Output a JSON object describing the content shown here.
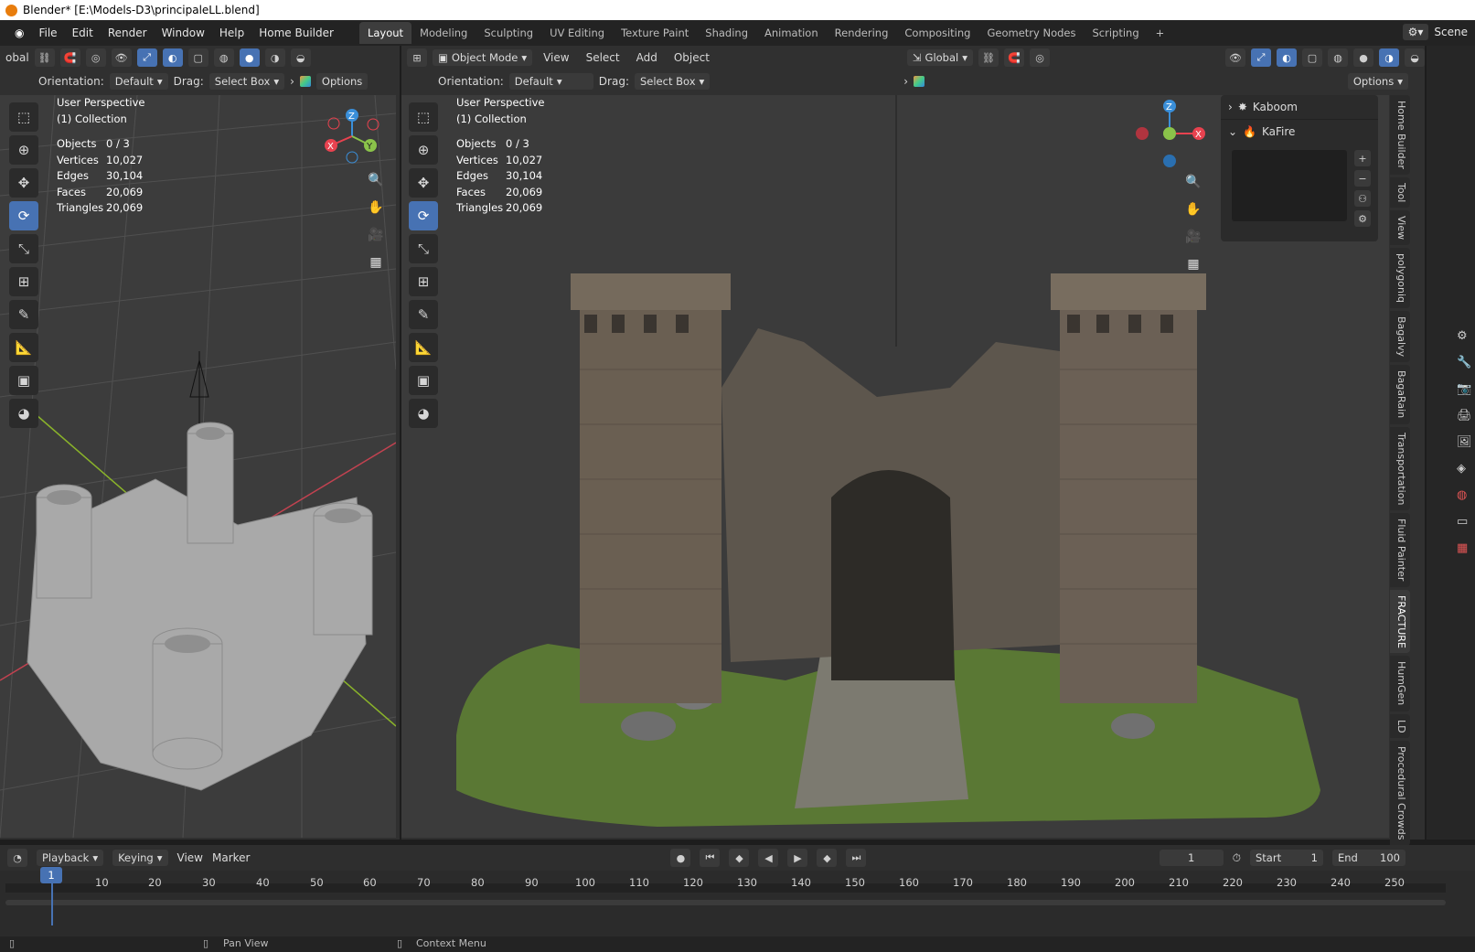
{
  "window_title": "Blender* [E:\\Models-D3\\principaleLL.blend]",
  "menu": [
    "File",
    "Edit",
    "Render",
    "Window",
    "Help",
    "Home Builder"
  ],
  "workspaces": [
    "Layout",
    "Modeling",
    "Sculpting",
    "UV Editing",
    "Texture Paint",
    "Shading",
    "Animation",
    "Rendering",
    "Compositing",
    "Geometry Nodes",
    "Scripting"
  ],
  "active_workspace": "Layout",
  "scene_label": "Scene",
  "left_viewport": {
    "transform_orientation": "obal",
    "orientation_label": "Orientation:",
    "orientation_value": "Default",
    "drag_label": "Drag:",
    "drag_value": "Select Box",
    "options_label": "Options",
    "perspective": "User Perspective",
    "collection": "(1) Collection"
  },
  "right_viewport": {
    "mode": "Object Mode",
    "menus": [
      "View",
      "Select",
      "Add",
      "Object"
    ],
    "transform_orientation": "Global",
    "orientation_label": "Orientation:",
    "orientation_value": "Default",
    "drag_label": "Drag:",
    "drag_value": "Select Box",
    "options_label": "Options",
    "perspective": "User Perspective",
    "collection": "(1) Collection"
  },
  "stats": {
    "objects_label": "Objects",
    "objects": "0 / 3",
    "vertices_label": "Vertices",
    "vertices": "10,027",
    "edges_label": "Edges",
    "edges": "30,104",
    "faces_label": "Faces",
    "faces": "20,069",
    "triangles_label": "Triangles",
    "triangles": "20,069"
  },
  "gizmo_axes": {
    "x": "X",
    "y": "Y",
    "z": "Z"
  },
  "sidebar_panels": [
    {
      "label": "Kaboom",
      "expanded": false
    },
    {
      "label": "KaFire",
      "expanded": true
    }
  ],
  "sidebar_tabs": [
    "Home Builder",
    "Tool",
    "View",
    "polygoniq",
    "Bagalvy",
    "BagaRain",
    "Transportation",
    "Fluid Painter",
    "FRACTURE",
    "HumGen",
    "LD",
    "Procedural Crowds"
  ],
  "timeline": {
    "menus": [
      "Playback",
      "Keying",
      "View",
      "Marker"
    ],
    "current_frame": "1",
    "start_label": "Start",
    "start": "1",
    "end_label": "End",
    "end": "100",
    "ticks": [
      "1",
      "10",
      "20",
      "30",
      "40",
      "50",
      "60",
      "70",
      "80",
      "90",
      "100",
      "110",
      "120",
      "130",
      "140",
      "150",
      "160",
      "170",
      "180",
      "190",
      "200",
      "210",
      "220",
      "230",
      "240",
      "250"
    ]
  },
  "status": {
    "pan_view": "Pan View",
    "context_menu": "Context Menu"
  },
  "colors": {
    "accent": "#4772b3",
    "x_axis": "#e8424f",
    "y_axis": "#8bc34a",
    "z_axis": "#3a8fd9",
    "terrain": "#5f7c35",
    "stone": "#6a5f52"
  }
}
